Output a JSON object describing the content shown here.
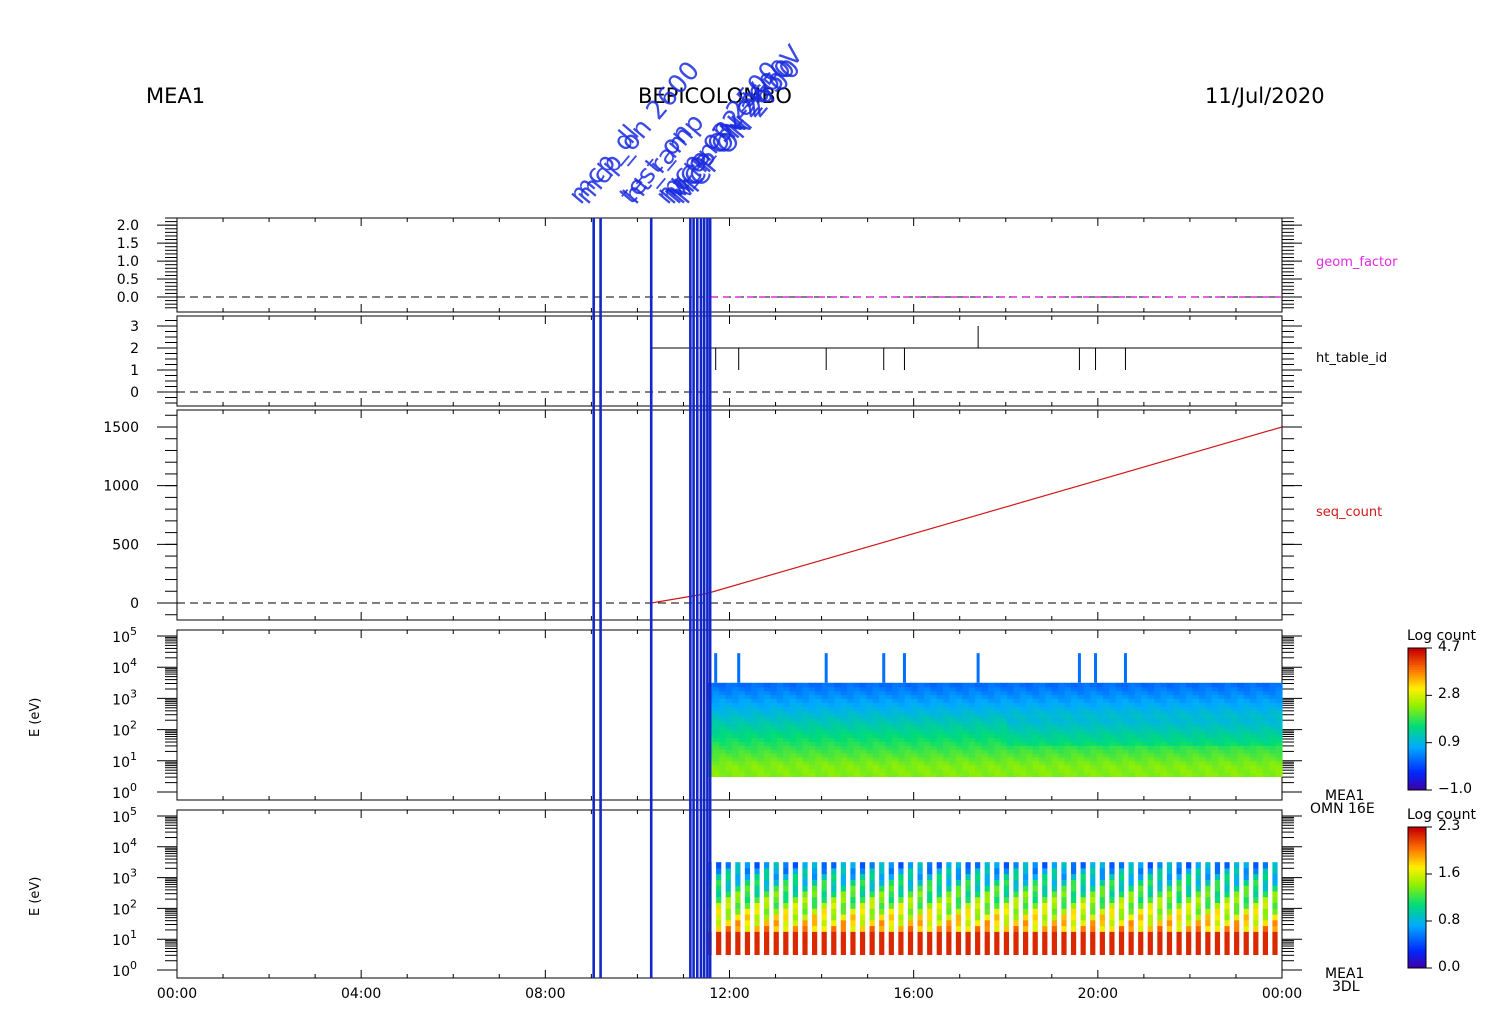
{
  "header": {
    "left": "MEA1",
    "center": "BEPICOLOMBO",
    "right": "11/Jul/2020"
  },
  "event_labels": [
    {
      "time": 9.1,
      "text": "mcp_dl"
    },
    {
      "time": 9.25,
      "text": "mcp_on 2600"
    },
    {
      "time": 10.2,
      "text": "test_on"
    },
    {
      "time": 10.3,
      "text": "ht_ramp"
    },
    {
      "time": 11.0,
      "text": "mcp_on 2500"
    },
    {
      "time": 11.1,
      "text": "ht_on 32eV"
    },
    {
      "time": 11.2,
      "text": "MCP ON 2600V"
    },
    {
      "time": 11.3,
      "text": "MCP ON 2650"
    },
    {
      "time": 11.4,
      "text": "MCP ON 2700"
    }
  ],
  "chart_data": [
    {
      "type": "line",
      "name": "geom_factor",
      "ylabel": "geom_factor",
      "ylim": [
        0,
        2.2
      ],
      "ytick_labels": [
        "2.0",
        "1.5",
        "1.0",
        "0.5",
        "0.0"
      ],
      "yticks": [
        2.0,
        1.5,
        1.0,
        0.5,
        0.0
      ],
      "color": "#e02be0",
      "series": [
        {
          "x": [
            11.6,
            24.0
          ],
          "y": [
            0,
            0
          ],
          "dashed": true
        }
      ]
    },
    {
      "type": "line",
      "name": "ht_table_id",
      "ylabel": "ht_table_id",
      "ylim": [
        -0.3,
        3.3
      ],
      "ytick_labels": [
        "3",
        "2",
        "1",
        "0"
      ],
      "yticks": [
        3,
        2,
        1,
        0
      ],
      "color": "#000000",
      "baseline": {
        "x": [
          10.3,
          24.0
        ],
        "y": 2
      },
      "spikes_down": [
        11.7,
        12.2,
        14.1,
        15.35,
        15.8,
        19.6,
        19.95,
        20.6
      ],
      "spikes_up": [
        17.4
      ]
    },
    {
      "type": "line",
      "name": "seq_count",
      "ylabel": "seq_count",
      "ylim": [
        -150,
        1700
      ],
      "ytick_labels": [
        "1500",
        "1000",
        "500",
        "0"
      ],
      "yticks": [
        1500,
        1000,
        500,
        0
      ],
      "color": "#d01818",
      "series": [
        {
          "x": [
            10.3,
            11.5,
            24.0
          ],
          "y": [
            0,
            80,
            1500
          ]
        }
      ]
    },
    {
      "type": "heatmap",
      "name": "MEA1 OMN 16E",
      "ylabel": "E (eV)",
      "ylim_log": [
        0,
        5
      ],
      "ytick_labels": [
        "10^5",
        "10^4",
        "10^3",
        "10^2",
        "10^1",
        "10^0"
      ],
      "colorbar": {
        "title": "Log count",
        "ticks": [
          "4.7",
          "2.8",
          "0.9",
          "−1.0"
        ],
        "range": [
          -1.0,
          4.7
        ]
      },
      "data_x_range": [
        11.5,
        24.0
      ],
      "data_logE_range": [
        0.5,
        3.5
      ],
      "spikes": [
        11.7,
        12.2,
        14.1,
        15.35,
        15.8,
        17.4,
        19.6,
        19.95,
        20.6
      ],
      "label": [
        "MEA1",
        "OMN 16E"
      ]
    },
    {
      "type": "heatmap",
      "name": "MEA1 3DL",
      "ylabel": "E (eV)",
      "ylim_log": [
        0,
        5
      ],
      "ytick_labels": [
        "10^5",
        "10^4",
        "10^3",
        "10^2",
        "10^1",
        "10^0"
      ],
      "colorbar": {
        "title": "Log count",
        "ticks": [
          "2.3",
          "1.6",
          "0.8",
          "0.0"
        ],
        "range": [
          0.0,
          2.3
        ]
      },
      "data_x_range": [
        11.5,
        24.0
      ],
      "data_logE_range": [
        0.5,
        3.5
      ],
      "label": [
        "MEA1",
        "3DL"
      ]
    }
  ],
  "xaxis": {
    "range": [
      0,
      24
    ],
    "tick_labels": [
      "00:00",
      "04:00",
      "08:00",
      "12:00",
      "16:00",
      "20:00",
      "00:00"
    ],
    "ticks": [
      0,
      4,
      8,
      12,
      16,
      20,
      24
    ]
  },
  "vertical_markers": [
    9.05,
    9.2,
    10.3,
    11.15,
    11.22,
    11.3,
    11.38,
    11.45,
    11.52,
    11.58
  ]
}
